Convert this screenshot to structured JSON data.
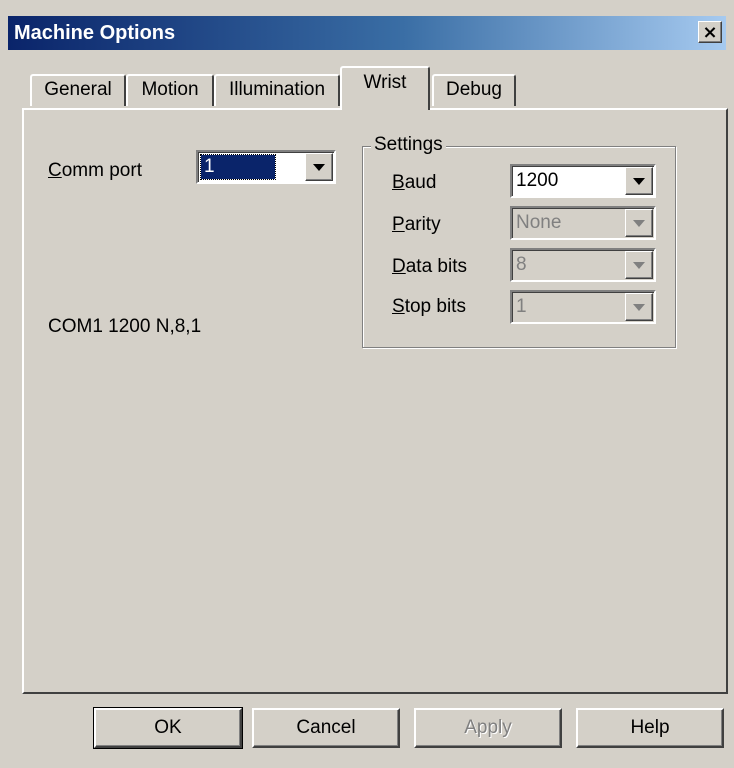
{
  "window": {
    "title": "Machine Options",
    "close_glyph": "×"
  },
  "tabs": [
    {
      "label": "General"
    },
    {
      "label": "Motion"
    },
    {
      "label": "Illumination"
    },
    {
      "label": "Wrist",
      "active": true
    },
    {
      "label": "Debug"
    }
  ],
  "comm_port": {
    "label_mnemonic": "C",
    "label_rest": "omm port",
    "value": "1"
  },
  "settings": {
    "title": "Settings",
    "baud": {
      "label_mnemonic": "B",
      "label_rest": "aud",
      "value": "1200",
      "enabled": true
    },
    "parity": {
      "label_mnemonic": "P",
      "label_rest": "arity",
      "value": "None",
      "enabled": false
    },
    "data_bits": {
      "label_mnemonic": "D",
      "label_rest": "ata bits",
      "value": "8",
      "enabled": false
    },
    "stop_bits": {
      "label_mnemonic": "S",
      "label_rest": "top bits",
      "value": "1",
      "enabled": false
    }
  },
  "status_text": "COM1 1200  N,8,1",
  "buttons": {
    "ok": "OK",
    "cancel": "Cancel",
    "apply": "Apply",
    "help": "Help"
  },
  "icons": {
    "dropdown": "chevron-down-icon",
    "close": "close-icon"
  },
  "colors": {
    "title_start": "#0a246a",
    "title_end": "#a6caf0",
    "face": "#d4d0c8",
    "selection": "#0a246a"
  }
}
